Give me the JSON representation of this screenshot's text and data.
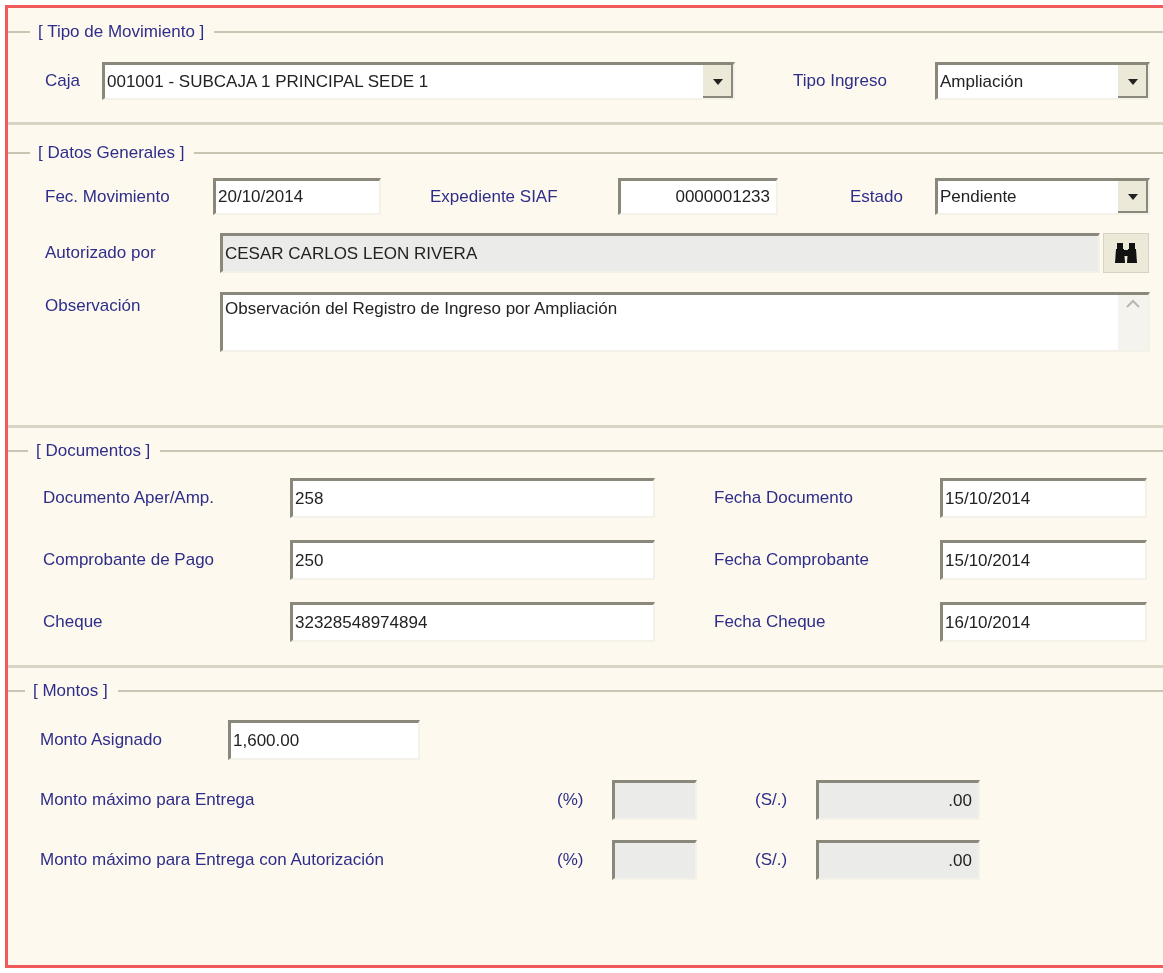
{
  "tipo_movimiento": {
    "legend": "[ Tipo de Movimiento ]",
    "caja": {
      "label": "Caja",
      "value": "001001 - SUBCAJA 1 PRINCIPAL SEDE 1",
      "disabled": false
    },
    "tipo_ingreso": {
      "label": "Tipo Ingreso",
      "value": "Ampliación",
      "disabled": false
    }
  },
  "datos_generales": {
    "legend": "[ Datos Generales ]",
    "fec_movimiento": {
      "label": "Fec. Movimiento",
      "value": "20/10/2014",
      "disabled": false
    },
    "expediente_siaf": {
      "label": "Expediente SIAF",
      "value": "0000001233",
      "disabled": false
    },
    "estado": {
      "label": "Estado",
      "value": "Pendiente",
      "disabled": false
    },
    "autorizado_por": {
      "label": "Autorizado por",
      "value": "CESAR CARLOS LEON RIVERA",
      "disabled": true
    },
    "observacion": {
      "label": "Observación",
      "value": "Observación del Registro de Ingreso por Ampliación",
      "disabled": false
    }
  },
  "documentos": {
    "legend": "[ Documentos ]",
    "rows": [
      {
        "label": "Documento Aper/Amp.",
        "value": "258",
        "date_label": "Fecha Documento",
        "date_value": "15/10/2014"
      },
      {
        "label": "Comprobante de Pago",
        "value": "250",
        "date_label": "Fecha Comprobante",
        "date_value": "15/10/2014"
      },
      {
        "label": "Cheque",
        "value": "32328548974894",
        "date_label": "Fecha Cheque",
        "date_value": "16/10/2014"
      }
    ]
  },
  "montos": {
    "legend": "[ Montos ]",
    "monto_asignado": {
      "label": "Monto Asignado",
      "value": "1,600.00",
      "disabled": false
    },
    "rows": [
      {
        "label": "Monto máximo para Entrega",
        "percent_label": "(%)",
        "percent_disabled": true,
        "amount_label": "(S/.)",
        "amount_value": ".00",
        "amount_disabled": true
      },
      {
        "label": "Monto máximo para Entrega con Autorización",
        "percent_label": "(%)",
        "percent_disabled": true,
        "amount_label": "(S/.)",
        "amount_value": ".00",
        "amount_disabled": true
      }
    ]
  }
}
